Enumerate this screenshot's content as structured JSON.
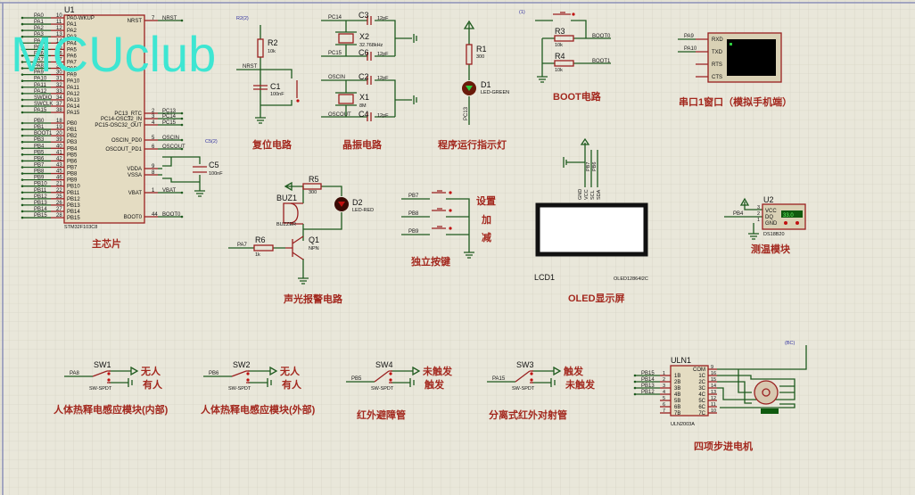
{
  "colors": {
    "wire": "#1e5a1e",
    "component": "#9a2020",
    "label": "#a3281e",
    "watermark": "#3ee6d2",
    "background": "#e9e7da"
  },
  "watermark": "MCUclub",
  "mcu": {
    "ref": "U1",
    "part": "STM32F103C8",
    "section": "主芯片",
    "pa_pins": [
      {
        "n": "10",
        "name": "PA0-WKUP",
        "net": "PA0"
      },
      {
        "n": "11",
        "name": "PA1",
        "net": "PA1"
      },
      {
        "n": "12",
        "name": "PA2",
        "net": "PA2"
      },
      {
        "n": "13",
        "name": "PA3",
        "net": "PA3"
      },
      {
        "n": "14",
        "name": "PA4",
        "net": "PA4"
      },
      {
        "n": "15",
        "name": "PA5",
        "net": "PA5"
      },
      {
        "n": "16",
        "name": "PA6",
        "net": "PA6"
      },
      {
        "n": "17",
        "name": "PA7",
        "net": "PA7"
      },
      {
        "n": "29",
        "name": "PA8",
        "net": "PA8"
      },
      {
        "n": "30",
        "name": "PA9",
        "net": "PA9"
      },
      {
        "n": "31",
        "name": "PA10",
        "net": "PA10"
      },
      {
        "n": "32",
        "name": "PA11",
        "net": "PA11"
      },
      {
        "n": "33",
        "name": "PA12",
        "net": "PA12"
      },
      {
        "n": "34",
        "name": "PA13",
        "net": "SWDIO"
      },
      {
        "n": "37",
        "name": "PA14",
        "net": "SWCLK"
      },
      {
        "n": "38",
        "name": "PA15",
        "net": "PA15"
      }
    ],
    "pb_pins": [
      {
        "n": "18",
        "name": "PB0",
        "net": "PB0"
      },
      {
        "n": "19",
        "name": "PB1",
        "net": "PB1"
      },
      {
        "n": "20",
        "name": "PB2",
        "net": "BOOT1"
      },
      {
        "n": "39",
        "name": "PB3",
        "net": "PB3"
      },
      {
        "n": "40",
        "name": "PB4",
        "net": "PB4"
      },
      {
        "n": "41",
        "name": "PB5",
        "net": "PB5"
      },
      {
        "n": "42",
        "name": "PB6",
        "net": "PB6"
      },
      {
        "n": "43",
        "name": "PB7",
        "net": "PB7"
      },
      {
        "n": "45",
        "name": "PB8",
        "net": "PB8"
      },
      {
        "n": "46",
        "name": "PB9",
        "net": "PB9"
      },
      {
        "n": "21",
        "name": "PB10",
        "net": "PB10"
      },
      {
        "n": "22",
        "name": "PB11",
        "net": "PB11"
      },
      {
        "n": "25",
        "name": "PB12",
        "net": "PB12"
      },
      {
        "n": "26",
        "name": "PB13",
        "net": "PB13"
      },
      {
        "n": "27",
        "name": "PB14",
        "net": "PB14"
      },
      {
        "n": "28",
        "name": "PB15",
        "net": "PB15"
      }
    ],
    "right_pins": [
      {
        "n": "7",
        "name": "NRST",
        "net": "NRST"
      },
      {
        "n": "2",
        "name": "PC13_RTC",
        "net": "PC13"
      },
      {
        "n": "3",
        "name": "PC14-OSC32_IN",
        "net": "PC14"
      },
      {
        "n": "4",
        "name": "PC15-OSC32_OUT",
        "net": "PC15"
      },
      {
        "n": "5",
        "name": "OSCIN_PD0",
        "net": "OSCIN"
      },
      {
        "n": "6",
        "name": "OSCOUT_PD1",
        "net": "OSCOUT"
      },
      {
        "n": "9",
        "name": "VDDA",
        "net": ""
      },
      {
        "n": "8",
        "name": "VSSA",
        "net": ""
      },
      {
        "n": "1",
        "name": "VBAT",
        "net": "VBAT"
      },
      {
        "n": "44",
        "name": "BOOT0",
        "net": "BOOT0"
      }
    ],
    "c5": {
      "ref": "C5",
      "value": "100nF",
      "probe": "C5(2)"
    }
  },
  "reset": {
    "section": "复位电路",
    "r_ref": "R2",
    "r_val": "10k",
    "c_ref": "C1",
    "c_val": "100nF",
    "net": "NRST",
    "probe": "R2(2)"
  },
  "crystal": {
    "section": "晶振电路",
    "c3": "C3",
    "c6": "C6",
    "c2": "C2",
    "c4": "C4",
    "cval": "12pF",
    "x2": "X2",
    "x2_val": "32.768kHz",
    "x1": "X1",
    "x1_val": "8M",
    "nets": [
      "PC14",
      "PC15",
      "OSCIN",
      "OSCOUT"
    ]
  },
  "led": {
    "section": "程序运行指示灯",
    "r_ref": "R1",
    "r_val": "300",
    "d_ref": "D1",
    "d_val": "LED-GREEN",
    "net": "PC13"
  },
  "boot": {
    "section": "BOOT电路",
    "r3": "R3",
    "r4": "R4",
    "rval": "10k",
    "net0": "BOOT0",
    "net1": "BOOT1",
    "probe": "(1)"
  },
  "uart": {
    "section": "串口1窗口（模拟手机端）",
    "pins": [
      "RXD",
      "TXD",
      "RTS",
      "CTS"
    ],
    "nets": [
      "PA9",
      "PA10"
    ]
  },
  "alarm": {
    "section": "声光报警电路",
    "r5": "R5",
    "r5_val": "300",
    "d2": "D2",
    "d2_val": "LED-RED",
    "buz": "BUZ1",
    "buz_val": "BUZZER",
    "r6": "R6",
    "r6_val": "1k",
    "q": "Q1",
    "q_val": "NPN",
    "net": "PA7"
  },
  "keys": {
    "section": "独立按键",
    "nets": [
      "PB7",
      "PB8",
      "PB9"
    ],
    "labels": [
      "设置",
      "加",
      "减"
    ]
  },
  "oled": {
    "section": "OLED显示屏",
    "ref": "LCD1",
    "part": "OLED12864I2C",
    "pins": [
      "GND",
      "VCC",
      "SCL",
      "SDA"
    ],
    "nets": [
      "PB7",
      "PB6"
    ]
  },
  "temp": {
    "section": "测温模块",
    "ref": "U2",
    "part": "DS18B20",
    "pins": [
      "VCC",
      "DQ",
      "GND"
    ],
    "nums": [
      "3",
      "2",
      "1"
    ],
    "net": "PB4",
    "reading": "33.0"
  },
  "switches": [
    {
      "ref": "SW1",
      "part": "SW-SPDT",
      "net": "PA8",
      "top": "无人",
      "bottom": "有人",
      "section": "人体热释电感应模块(内部)"
    },
    {
      "ref": "SW2",
      "part": "SW-SPDT",
      "net": "PB6",
      "top": "无人",
      "bottom": "有人",
      "section": "人体热释电感应模块(外部)"
    },
    {
      "ref": "SW4",
      "part": "SW-SPDT",
      "net": "PB5",
      "top": "未触发",
      "bottom": "触发",
      "section": "红外避障管"
    },
    {
      "ref": "SW3",
      "part": "SW-SPDT",
      "net": "PA15",
      "top": "触发",
      "bottom": "未触发",
      "section": "分离式红外对射管"
    }
  ],
  "stepper": {
    "section": "四项步进电机",
    "ref": "ULN1",
    "part": "ULN2003A",
    "probe": "(BC)",
    "left": [
      {
        "n": "1",
        "name": "1B",
        "net": "PB15"
      },
      {
        "n": "2",
        "name": "2B",
        "net": "PB14"
      },
      {
        "n": "3",
        "name": "3B",
        "net": "PB13"
      },
      {
        "n": "4",
        "name": "4B",
        "net": "PB12"
      },
      {
        "n": "5",
        "name": "5B",
        "net": ""
      },
      {
        "n": "6",
        "name": "6B",
        "net": ""
      },
      {
        "n": "7",
        "name": "7B",
        "net": ""
      }
    ],
    "right": [
      {
        "n": "9",
        "name": "COM"
      },
      {
        "n": "16",
        "name": "1C"
      },
      {
        "n": "15",
        "name": "2C"
      },
      {
        "n": "14",
        "name": "3C"
      },
      {
        "n": "13",
        "name": "4C"
      },
      {
        "n": "12",
        "name": "5C"
      },
      {
        "n": "11",
        "name": "6C"
      },
      {
        "n": "10",
        "name": "7C"
      }
    ]
  }
}
